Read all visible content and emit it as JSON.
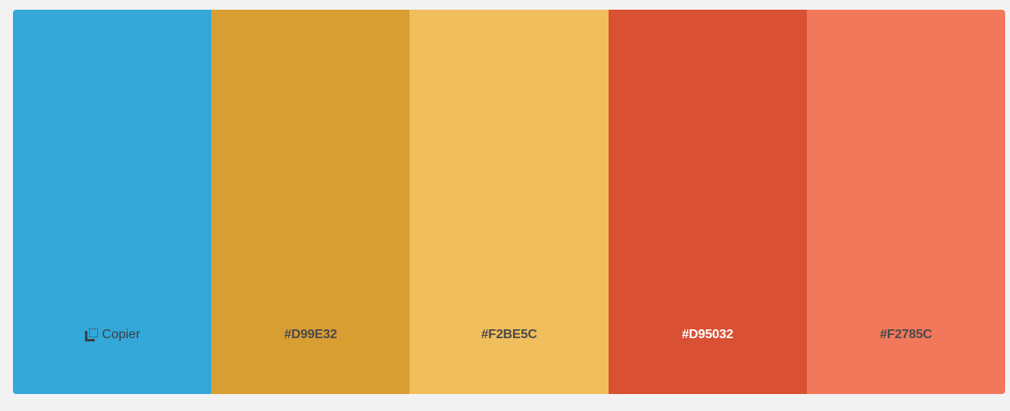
{
  "palette": {
    "swatches": [
      {
        "color": "#33A8D9",
        "label": "Copier",
        "hovered": true,
        "label_color": "#3e3e3e"
      },
      {
        "color": "#D99E32",
        "label": "#D99E32",
        "label_color": "#4a4a4a"
      },
      {
        "color": "#F0BE5C",
        "label": "#F2BE5C",
        "label_color": "#4a4a4a"
      },
      {
        "color": "#D95032",
        "label": "#D95032",
        "label_color": "#ffffff"
      },
      {
        "color": "#F2785C",
        "label": "#F2785C",
        "label_color": "#4a4a4a"
      }
    ],
    "copy_icon": "copy-icon"
  }
}
